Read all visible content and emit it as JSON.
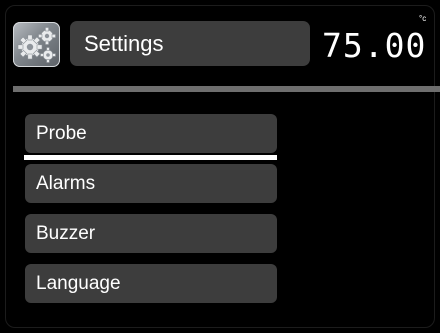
{
  "header": {
    "app_icon": "gears-icon",
    "title": "Settings",
    "temperature": "75.00",
    "temperature_unit": "°c"
  },
  "menu": {
    "items": [
      {
        "label": "Probe",
        "selected": true
      },
      {
        "label": "Alarms",
        "selected": false
      },
      {
        "label": "Buzzer",
        "selected": false
      },
      {
        "label": "Language",
        "selected": false
      }
    ]
  },
  "colors": {
    "background": "#000000",
    "panel": "#3d3d3d",
    "divider": "#6e6e6e",
    "text": "#ffffff"
  }
}
